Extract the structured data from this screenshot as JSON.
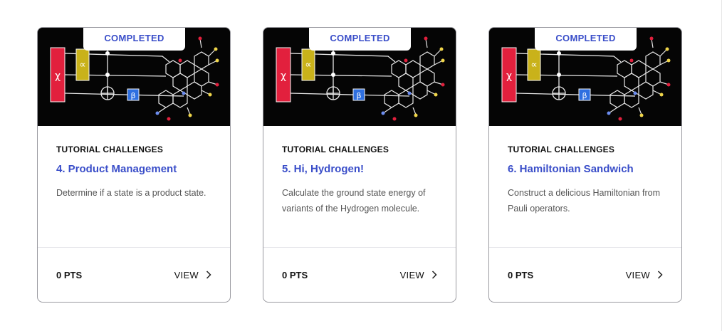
{
  "accent_color": "#3a4ec9",
  "cards": [
    {
      "badge": "COMPLETED",
      "category": "TUTORIAL CHALLENGES",
      "title": "4. Product Management",
      "description": "Determine if a state is a product state.",
      "points": "0 PTS",
      "view_label": "VIEW",
      "icons": [
        "chevron-right-icon"
      ]
    },
    {
      "badge": "COMPLETED",
      "category": "TUTORIAL CHALLENGES",
      "title": "5. Hi, Hydrogen!",
      "description": "Calculate the ground state energy of variants of the Hydrogen molecule.",
      "points": "0 PTS",
      "view_label": "VIEW",
      "icons": [
        "chevron-right-icon"
      ]
    },
    {
      "badge": "COMPLETED",
      "category": "TUTORIAL CHALLENGES",
      "title": "6. Hamiltonian Sandwich",
      "description": "Construct a delicious Hamiltonian from Pauli operators.",
      "points": "0 PTS",
      "view_label": "VIEW",
      "icons": [
        "chevron-right-icon"
      ]
    }
  ],
  "illustration": {
    "gate_labels": [
      "χ",
      "∝",
      "β"
    ],
    "colors": {
      "red_gate": "#e2203d",
      "yellow_gate": "#c9b21a",
      "blue_gate": "#2e6fe0",
      "wire": "#e8e8e8",
      "background": "#050505"
    }
  }
}
